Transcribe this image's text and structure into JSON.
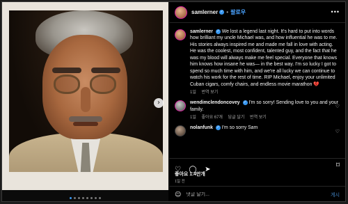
{
  "header": {
    "username": "samlerner",
    "separator": "•",
    "follow_label": "팔로우",
    "more_icon": "ellipsis-icon"
  },
  "caption": {
    "username": "samlerner",
    "text": "We lost a legend last night. It's hard to put into words how brilliant my uncle Michael was, and how influential he was to me. His stories always inspired me and made me fall in love with acting. He was the coolest, most confident, talented guy, and the fact that he was my blood will always make me feel special. Everyone that knows him knows how insane he was— in the best way. I'm so lucky I got to spend so much time with him, and we're all lucky we can continue to watch his work for the rest of time. RIP Michael, enjoy your unlimited Cuban cigars, comfy chairs, and endless movie marathon 💔",
    "time": "1일",
    "translate": "번역 보기"
  },
  "comments": [
    {
      "username": "wendimclendoncovey",
      "text": "I'm so sorry! Sending love to you and your family.",
      "time": "1일",
      "likes": "좋아요 67개",
      "reply": "답글 달기",
      "translate": "번역 보기"
    },
    {
      "username": "nolanfunk",
      "text": "I'm so sorry Sam"
    }
  ],
  "actions": {
    "like_icon": "heart-icon",
    "comment_icon": "comment-icon",
    "share_icon": "share-icon",
    "save_icon": "bookmark-icon"
  },
  "likes_text": "좋아요 1.4만개",
  "date_text": "1일 전",
  "add_comment": {
    "placeholder": "댓글 달기...",
    "post_label": "게시"
  },
  "colors": {
    "accent": "#3897f0",
    "follow": "#4aa3ff",
    "heart": "#e0245e"
  }
}
